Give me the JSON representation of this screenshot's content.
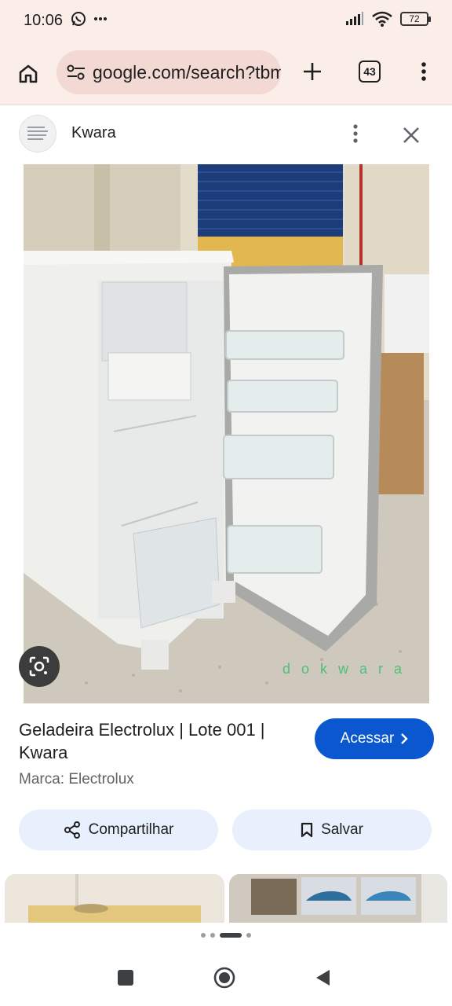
{
  "status": {
    "time": "10:06",
    "battery": "72",
    "icons": [
      "whatsapp-icon",
      "more-icon",
      "signal-icon",
      "wifi-icon",
      "battery-icon"
    ]
  },
  "browser": {
    "url": "google.com/search?tbm=isch",
    "tab_count": "43",
    "icons": [
      "home-icon",
      "tune-icon",
      "plus-icon",
      "tabs-icon",
      "menu-icon"
    ]
  },
  "source": {
    "name": "Kwara",
    "icons": [
      "more-vert-icon",
      "close-icon"
    ]
  },
  "result": {
    "title": "Geladeira Electrolux | Lote 001 | Kwara",
    "brand": "Marca: Electrolux",
    "visit_label": "Acessar",
    "share_label": "Compartilhar",
    "save_label": "Salvar",
    "image_watermark": "dokwara"
  },
  "colors": {
    "accent": "#0b57d0",
    "chip_bg": "#e8f0fe",
    "toolbar_bg": "#fbeee9"
  }
}
